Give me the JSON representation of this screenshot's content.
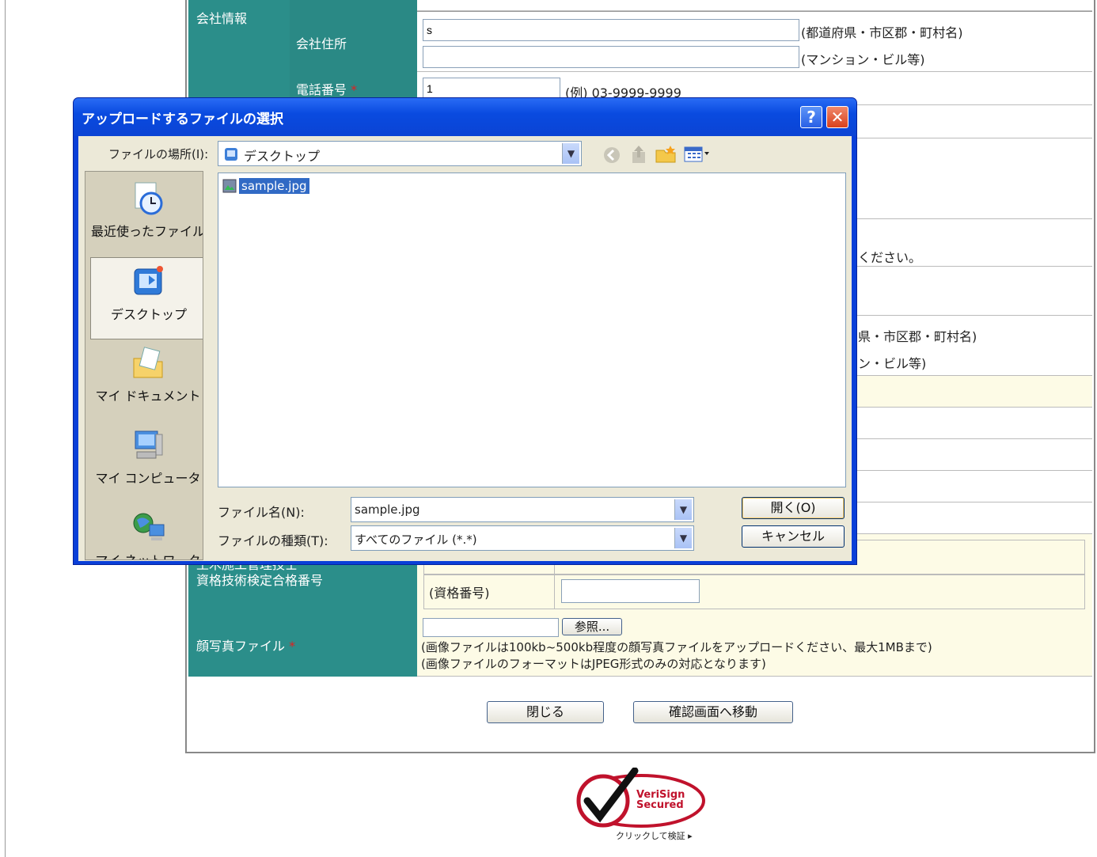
{
  "form": {
    "section_company": "会社情報",
    "company_address_label": "会社住所",
    "address1_value": "s",
    "address1_hint": "(都道府県・市区郡・町村名)",
    "address2_value": "",
    "address2_hint": "(マンション・ビル等)",
    "phone_label": "電話番号",
    "phone_value": "1",
    "phone_hint": "(例) 03-9999-9999",
    "required_mark": "*",
    "partial_text_1": "ください。",
    "partial_text_2": "県・市区郡・町村名)",
    "partial_text_3": "ン・ビル等)",
    "qualification_label_line1": "土木施工管理技士",
    "qualification_label_line2": "資格技術検定合格番号",
    "qualification_sub_label": "(資格番号)",
    "qualification_value": "",
    "photo_label": "顔写真ファイル",
    "photo_value": "",
    "browse_button": "参照...",
    "photo_note_1": "(画像ファイルは100kb~500kb程度の顔写真ファイルをアップロードください、最大1MBまで)",
    "photo_note_2": "(画像ファイルのフォーマットはJPEG形式のみの対応となります)",
    "close_button": "閉じる",
    "confirm_button": "確認画面へ移動"
  },
  "verisign": {
    "line1": "VeriSign",
    "line2": "Secured",
    "caption": "クリックして検証 ▸",
    "colors": {
      "ring": "#c0122c",
      "check": "#111111"
    }
  },
  "dialog": {
    "title": "アップロードするファイルの選択",
    "help_button": "?",
    "close_button": "✕",
    "look_in_label": "ファイルの場所(I):",
    "look_in_value": "デスクトップ",
    "places": [
      {
        "label": "最近使ったファイル",
        "icon": "recent-files-icon"
      },
      {
        "label": "デスクトップ",
        "icon": "desktop-icon"
      },
      {
        "label": "マイ ドキュメント",
        "icon": "my-documents-icon"
      },
      {
        "label": "マイ コンピュータ",
        "icon": "my-computer-icon"
      },
      {
        "label": "マイ ネットワーク",
        "icon": "my-network-icon"
      }
    ],
    "files": [
      {
        "name": "sample.jpg",
        "selected": true
      }
    ],
    "filename_label": "ファイル名(N):",
    "filename_value": "sample.jpg",
    "filetype_label": "ファイルの種類(T):",
    "filetype_value": "すべてのファイル (*.*)",
    "open_button": "開く(O)",
    "cancel_button": "キャンセル",
    "colors": {
      "titlebar": "#0a4be0",
      "client": "#ece9d8",
      "selection": "#316ac5"
    }
  }
}
